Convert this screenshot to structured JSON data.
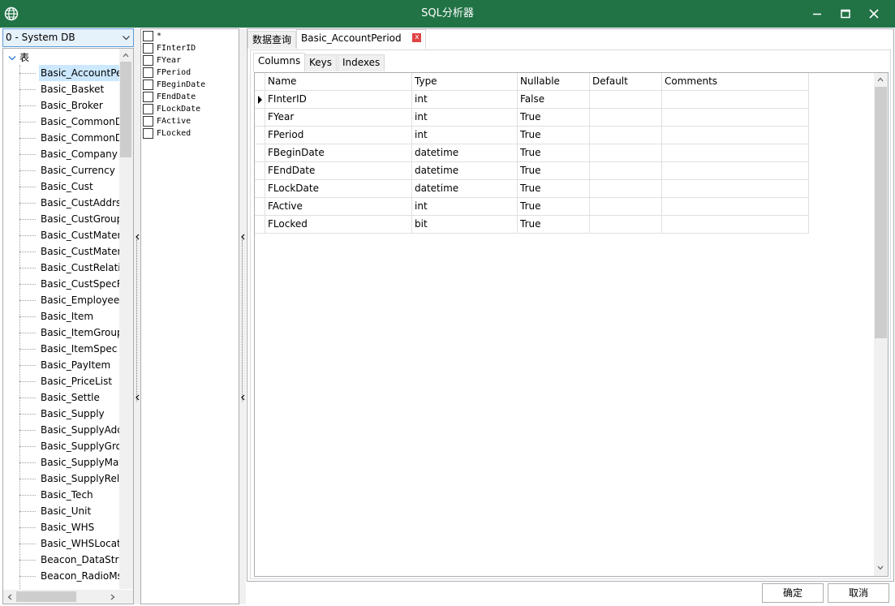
{
  "window": {
    "title": "SQL分析器",
    "controls": [
      "minimize",
      "maximize",
      "close"
    ]
  },
  "database_selector": {
    "value": "0 - System DB"
  },
  "tree": {
    "root_label": "表",
    "items": [
      "Basic_AccountPer",
      "Basic_Basket",
      "Basic_Broker",
      "Basic_CommonD",
      "Basic_CommonD",
      "Basic_Company",
      "Basic_Currency",
      "Basic_Cust",
      "Basic_CustAddrs",
      "Basic_CustGroup",
      "Basic_CustMateri",
      "Basic_CustMateri",
      "Basic_CustRelatic",
      "Basic_CustSpecR",
      "Basic_Employee",
      "Basic_Item",
      "Basic_ItemGroup",
      "Basic_ItemSpec",
      "Basic_PayItem",
      "Basic_PriceList",
      "Basic_Settle",
      "Basic_Supply",
      "Basic_SupplyAdd",
      "Basic_SupplyGro",
      "Basic_SupplyMat",
      "Basic_SupplyRela",
      "Basic_Tech",
      "Basic_Unit",
      "Basic_WHS",
      "Basic_WHSLocati",
      "Beacon_DataStru",
      "Beacon_RadioMs"
    ],
    "selected_index": 0
  },
  "column_checklist": [
    "*",
    "FInterID",
    "FYear",
    "FPeriod",
    "FBeginDate",
    "FEndDate",
    "FLockDate",
    "FActive",
    "FLocked"
  ],
  "document_tabs": [
    {
      "label": "数据查询",
      "active": false
    },
    {
      "label": "Basic_AccountPeriod",
      "active": true,
      "close": "x"
    }
  ],
  "inner_tabs": [
    {
      "label": "Columns",
      "active": true
    },
    {
      "label": "Keys",
      "active": false
    },
    {
      "label": "Indexes",
      "active": false
    }
  ],
  "grid": {
    "headers": [
      "Name",
      "Type",
      "Nullable",
      "Default",
      "Comments"
    ],
    "rows": [
      [
        "FInterID",
        "int",
        "False",
        "",
        ""
      ],
      [
        "FYear",
        "int",
        "True",
        "",
        ""
      ],
      [
        "FPeriod",
        "int",
        "True",
        "",
        ""
      ],
      [
        "FBeginDate",
        "datetime",
        "True",
        "",
        ""
      ],
      [
        "FEndDate",
        "datetime",
        "True",
        "",
        ""
      ],
      [
        "FLockDate",
        "datetime",
        "True",
        "",
        ""
      ],
      [
        "FActive",
        "int",
        "True",
        "",
        ""
      ],
      [
        "FLocked",
        "bit",
        "True",
        "",
        ""
      ]
    ],
    "current_row": 0
  },
  "buttons": {
    "ok": "确定",
    "cancel": "取消"
  },
  "colors": {
    "titlebar": "#217346",
    "selection": "#cce8ff",
    "close_tab": "#e04343"
  },
  "icons": {
    "app": "globe-icon",
    "expand": "chevron-down-icon",
    "row_indicator": "triangle-right-icon"
  }
}
